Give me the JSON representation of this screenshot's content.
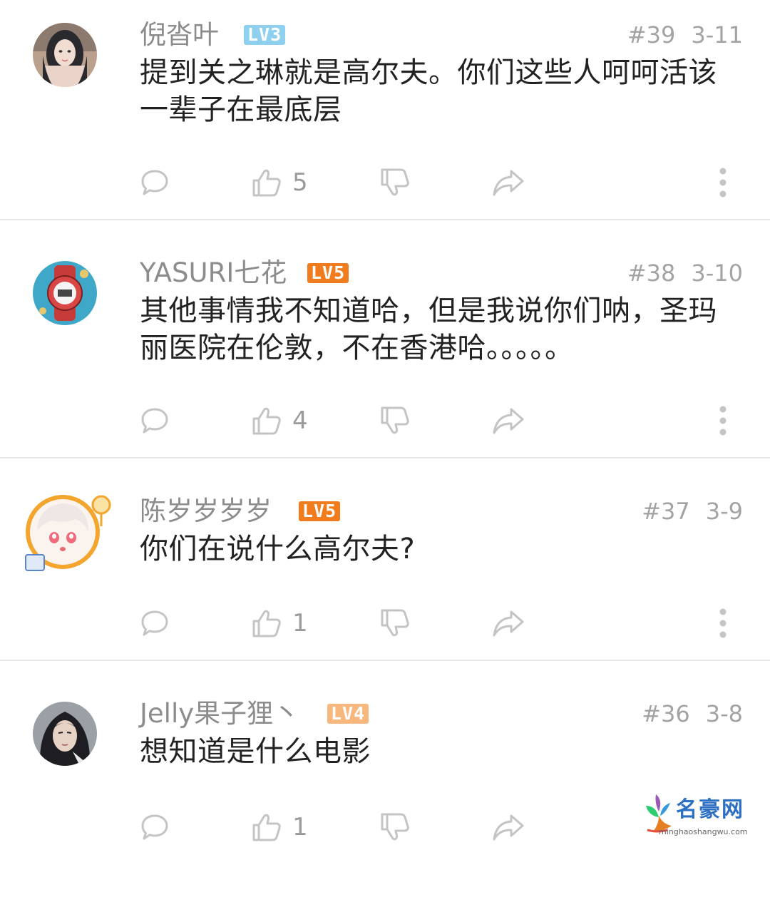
{
  "comments": [
    {
      "username": "倪沓叶",
      "level": "LV3",
      "level_color": "#8fd0ef",
      "floor": "#39",
      "date": "3-11",
      "text_line1": "提到关之琳就是高尔夫。你们这些人呵呵活该",
      "text_line2": "一辈子在最底层",
      "likes": "5",
      "avatar_icon": "avatar-woman-dark-hair"
    },
    {
      "username": "YASURI七花",
      "level": "LV5",
      "level_color": "#f07c1e",
      "floor": "#38",
      "date": "3-10",
      "text_line1": "其他事情我不知道哈，但是我说你们呐，圣玛",
      "text_line2": "丽医院在伦敦，不在香港哈。。。。。",
      "likes": "4",
      "avatar_icon": "avatar-red-watch"
    },
    {
      "username": "陈岁岁岁岁",
      "level": "LV5",
      "level_color": "#f07c1e",
      "floor": "#37",
      "date": "3-9",
      "text_line1": "你们在说什么高尔夫?",
      "text_line2": "",
      "likes": "1",
      "avatar_icon": "avatar-anime-girl"
    },
    {
      "username": "Jelly果子狸丶",
      "level": "LV4",
      "level_color": "#f7b77d",
      "floor": "#36",
      "date": "3-8",
      "text_line1": "想知道是什么电影",
      "text_line2": "",
      "likes": "1",
      "avatar_icon": "avatar-man-long-hair"
    }
  ],
  "watermark": {
    "title": "名豪网",
    "url": "minghaoshangwu.com"
  },
  "icons": [
    "reply-icon",
    "thumbs-up-icon",
    "thumbs-down-icon",
    "share-icon",
    "more-icon"
  ],
  "colors": {
    "icon_gray": "#c4c4c4",
    "text": "#222222",
    "meta": "#a3a3a3"
  }
}
